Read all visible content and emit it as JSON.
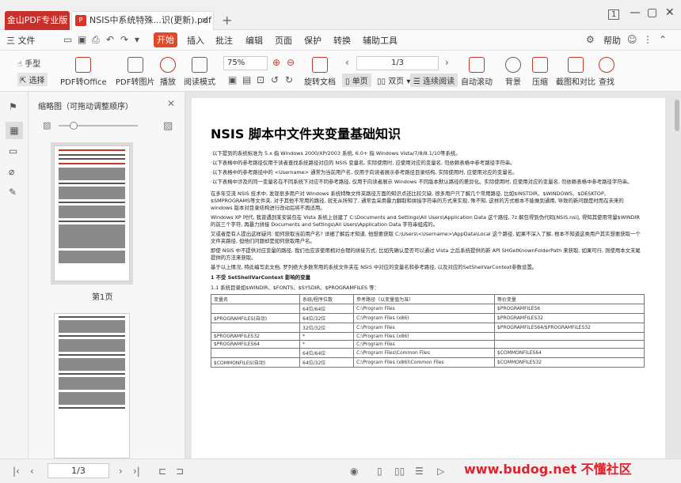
{
  "titlebar": {
    "home_tab": "金山PDF专业版",
    "doc_tab": "NSIS中系统特殊...识(更新).pdf",
    "page_badge": "1"
  },
  "menubar": {
    "file": "三 文件",
    "start": "开始",
    "items": [
      "插入",
      "批注",
      "编辑",
      "页面",
      "保护",
      "转换",
      "辅助工具"
    ],
    "help": "帮助"
  },
  "toolbar": {
    "hand": "手型",
    "select": "选择",
    "pdf_office": "PDF转Office",
    "pdf_image": "PDF转图片",
    "play": "播放",
    "read_mode": "阅读模式",
    "zoom": "75%",
    "rotate": "旋转文档",
    "page": "1/3",
    "single": "单页",
    "double": "双页",
    "continuous": "连续阅读",
    "auto_scroll": "自动滚动",
    "background": "背景",
    "compress": "压缩",
    "screenshot": "截图和对比",
    "search": "查找"
  },
  "thumbpanel": {
    "title": "缩略图（可拖动调整顺序）",
    "page1_label": "第1页"
  },
  "document": {
    "title": "NSIS 脚本中文件夹变量基础知识",
    "para1": "·以下提到的系统标准为 5.x 指 Windows 2000/XP/2003 系统, 6.0+ 指 Windows Vista/7/8/8.1/10等系统。",
    "para2": "·以下表格中的参考路径仅用于读者查找系统路径对应的 NSIS 变量名, 实际使用时, 应使用对应的变量名, 勿依赖表格中参考路径字符串。",
    "para3": "·以下表格中的参考路径中的 <Username> 通常为当前用户名, 仅用于向读者展示参考路径目录结构, 实际使用时, 应使用对应的变量名。",
    "para4": "·以下表格中涉及的同一变量名在不同系统下对应不同参考路径, 仅用于向读者展示 Windows 不同版本默认路径的差异化。实际使用时, 应使用对应的变量名, 勿依赖表格中参考路径字符串。",
    "para5": "在多年交流 NSIS 技术中, 发现很多用户对 Windows 系统特殊文件夹路径方面的知识点还比较欠缺, 很多用户只了解几个常用路径, 比如$INSTDIR、$WINDOWS、$DESKTOP、$SMPROGRAMS等文件夹, 对于其他不常用的路径, 就无从所知了, 通常会采用暴力翻取和拼接字符串的方式来实现, 殊不知, 这样的方式根本不能做到通用, 导致的新问题是时而在未来的 windows 版本对目录结构进行改动后将不再适用。",
    "para6": "Windows XP 时代, 我曾遇到某安装包在 Vista 系统上创建了 C:\\Documents and Settings\\All Users\\Application Data 这个路径, 7z 解包得到伪代码[NSIS.nsi], 得知其使用常量$WINDIR 的前三个字符, 再暴力拼接 Documents and Settings\\All Users\\Application Data 字符串组成的。",
    "para7": "又或者是有人提出这样疑问: 如何获取当前用户名? 详细了解后才知道, 他想要获取 C:\\Users\\<Username>\\AppData\\Local 这个路径, 如果不深入了解, 根本不知道这类用户其实想要获取一个文件夹路径, 但他们问题却是如何获取用户名。",
    "para8": "即使 NSIS 中不提供对应变量的路径, 我们也应该使用相对合理的拼接方式, 比如先确认是否可以通过 Vista 之后系统提供的新 API SHGetKnownFolderPath 来获取, 如果可行, 则使用本文末尾提供的方法来获取。",
    "para9": "基于以上情况, 特此编写此文档, 罗列绝大多数常用的系统文件夹在 NSIS 中对应的变量名和参考路径, 以及对应的SetShellVarContext参数设置。",
    "sec1": "1        不受 SetShellVarContext 影响的变量",
    "sec11": "1.1       系统目录如$WINDIR、$FONTS、$SYSDIR、$PROGRAMFILES 等：",
    "table": {
      "headers": [
        "变量名",
        "系统/程序位数",
        "参考路径（以变量值为准）",
        "等价变量"
      ],
      "rows": [
        [
          "",
          "64位/64位",
          "C:\\Program Files",
          "$PROGRAMFILES6"
        ],
        [
          "$PROGRAMFILES(自动)",
          "64位/32位",
          "C:\\Program Files (x86)",
          "$PROGRAMFILES32"
        ],
        [
          "",
          "32位/32位",
          "C:\\Program Files",
          "$PROGRAMFILES64/$PROGRAMFILES32"
        ],
        [
          "$PROGRAMFILES32",
          "*",
          "C:\\Program Files (x86)",
          ""
        ],
        [
          "$PROGRAMFILES64",
          "*",
          "C:\\Program Files",
          ""
        ],
        [
          "",
          "64位/64位",
          "C:\\Program Files\\Common Files",
          "$COMMONFILES64"
        ],
        [
          "$COMMONFILES(自动)",
          "64位/32位",
          "C:\\Program Files (x86)\\Common Files",
          "$COMMONFILES32"
        ]
      ]
    }
  },
  "statusbar": {
    "page": "1/3"
  },
  "watermark": "www.budog.net 不懂社区"
}
